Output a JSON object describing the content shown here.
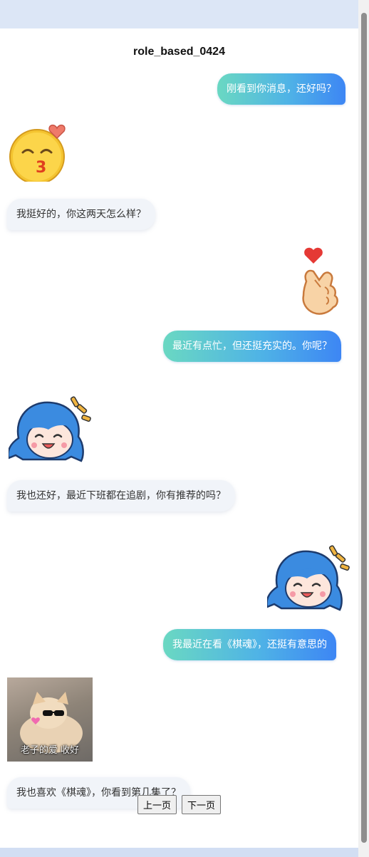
{
  "title": "role_based_0424",
  "messages": [
    {
      "type": "text",
      "from": "me",
      "text": "刚看到你消息，还好吗？"
    },
    {
      "type": "sticker",
      "from": "other",
      "icon": "kissing-face-with-heart-icon"
    },
    {
      "type": "text",
      "from": "other",
      "text": "我挺好的，你这两天怎么样？"
    },
    {
      "type": "sticker",
      "from": "me",
      "icon": "finger-heart-hand-icon"
    },
    {
      "type": "text",
      "from": "me",
      "text": "最近有点忙，但还挺充实的。你呢？"
    },
    {
      "type": "sticker",
      "from": "other",
      "icon": "laughing-anime-girl-icon"
    },
    {
      "type": "text",
      "from": "other",
      "text": "我也还好，最近下班都在追剧，你有推荐的吗？"
    },
    {
      "type": "sticker",
      "from": "me",
      "icon": "laughing-anime-girl-icon"
    },
    {
      "type": "text",
      "from": "me",
      "text": "我最近在看《棋魂》，还挺有意思的"
    },
    {
      "type": "image",
      "from": "other",
      "caption": "老子的爱 收好"
    },
    {
      "type": "text",
      "from": "other",
      "text": "我也喜欢《棋魂》，你看到第几集了？"
    }
  ],
  "pager": {
    "prev": "上一页",
    "next": "下一页"
  },
  "colors": {
    "bubble_me_start": "#6ad8c2",
    "bubble_me_end": "#3d86f4",
    "bubble_other": "#f1f4f9",
    "background": "#dfe8f7"
  }
}
